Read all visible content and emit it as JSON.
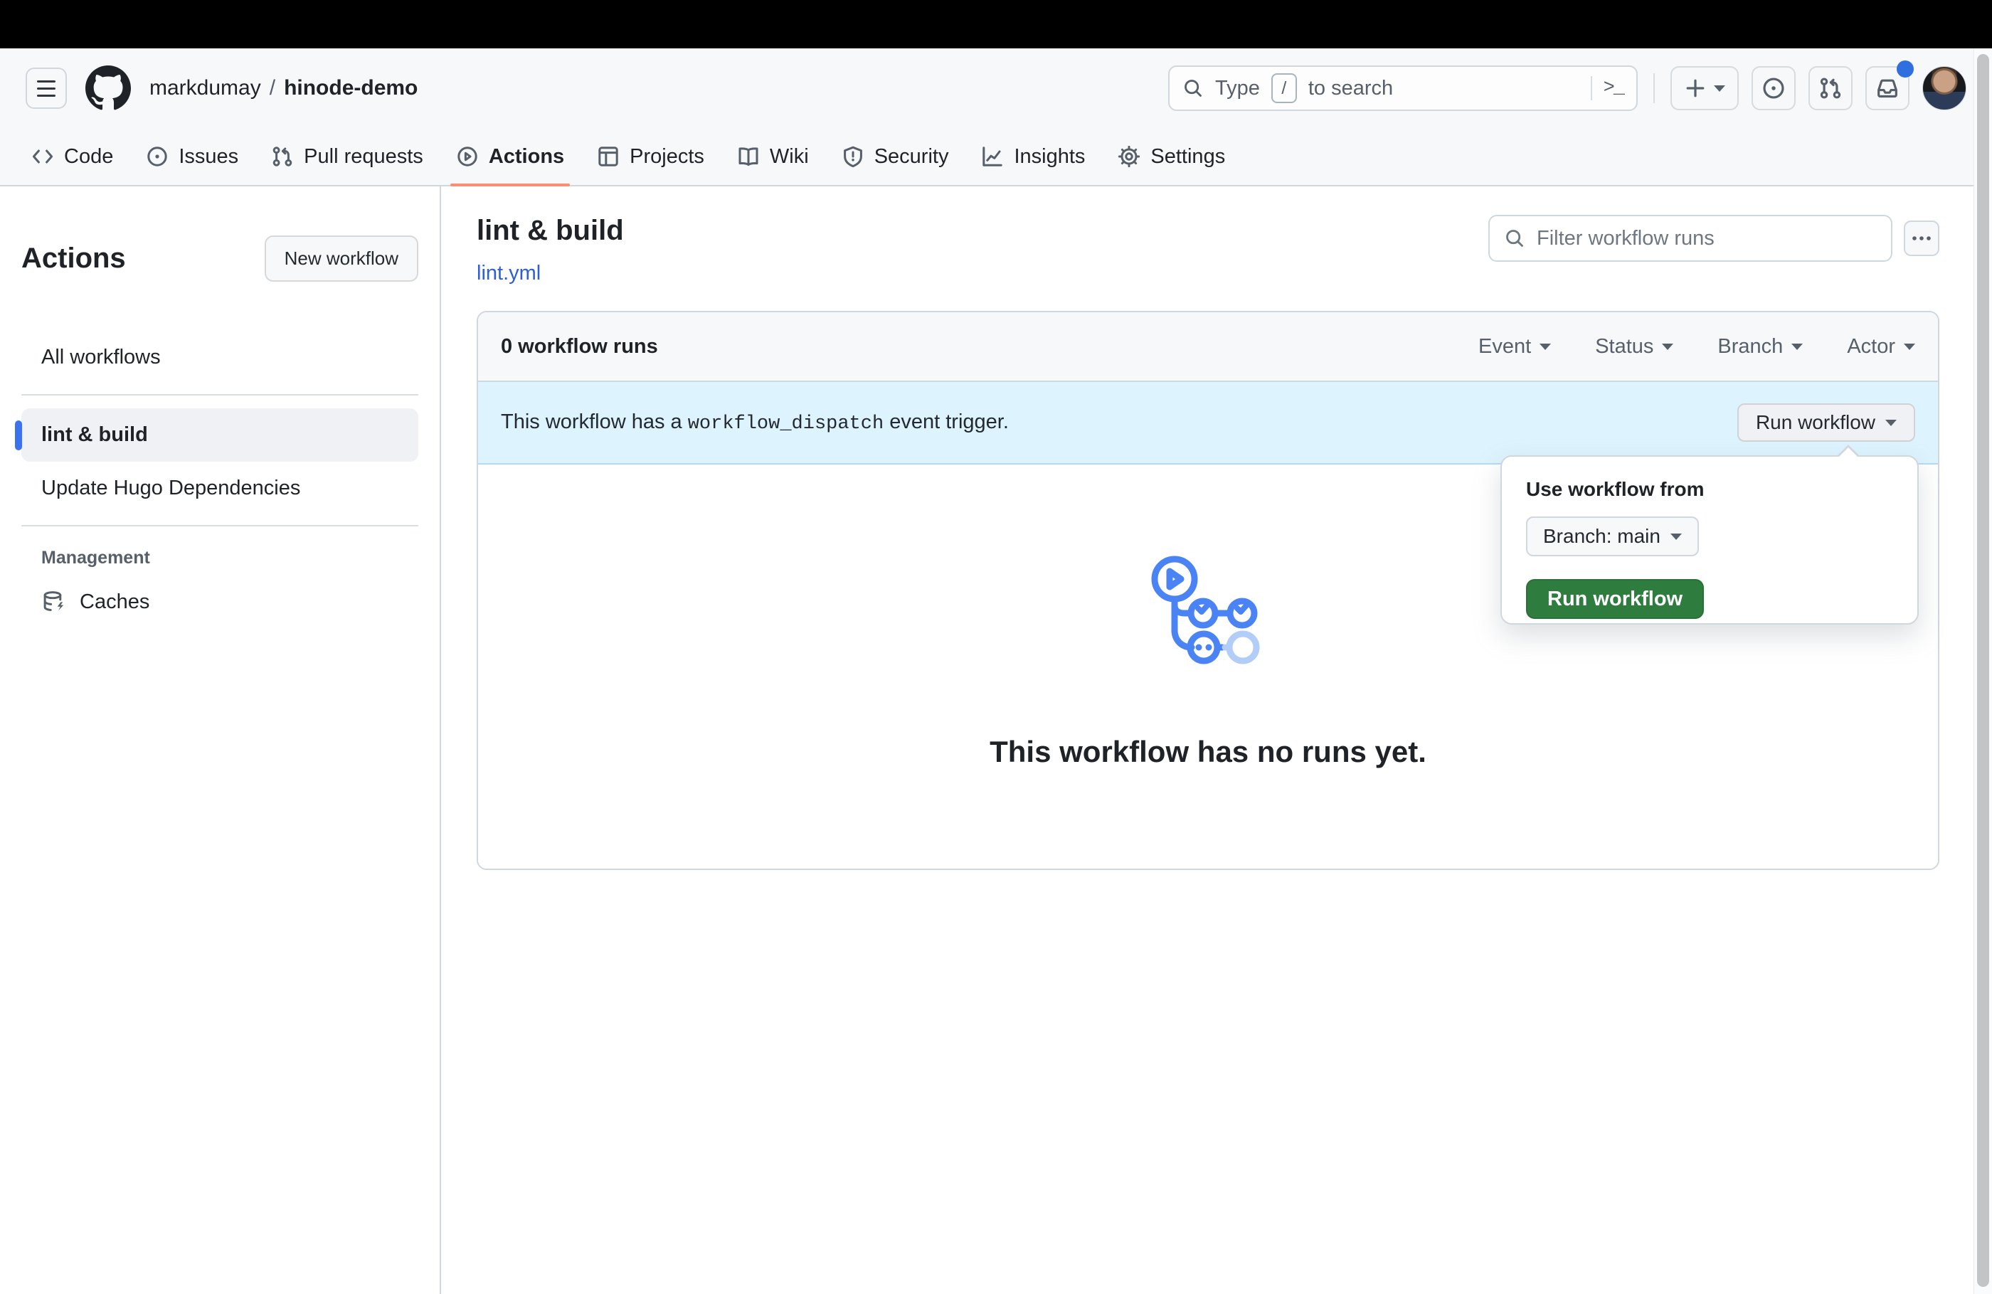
{
  "chrome": {
    "breadcrumb": {
      "owner": "markdumay",
      "separator": "/",
      "repo": "hinode-demo"
    },
    "search": {
      "pre": "Type",
      "slash_key": "/",
      "post": "to search",
      "terminal_glyph": ">_"
    },
    "nav": [
      "Code",
      "Issues",
      "Pull requests",
      "Actions",
      "Projects",
      "Wiki",
      "Security",
      "Insights",
      "Settings"
    ]
  },
  "sidebar": {
    "title": "Actions",
    "new_workflow_button": "New workflow",
    "all_workflows": "All workflows",
    "workflows": [
      "lint & build",
      "Update Hugo Dependencies"
    ],
    "selected_workflow": "lint & build",
    "management_label": "Management",
    "caches": "Caches"
  },
  "main": {
    "title": "lint & build",
    "file_link": "lint.yml",
    "filter_placeholder": "Filter workflow runs",
    "kebab_glyph": "⋯",
    "runs_count": "0 workflow runs",
    "filters": [
      "Event",
      "Status",
      "Branch",
      "Actor"
    ],
    "banner": {
      "pre": "This workflow has a",
      "code": "workflow_dispatch",
      "post": "event trigger."
    },
    "run_workflow_button": "Run workflow",
    "empty_heading": "This workflow has no runs yet."
  },
  "popup": {
    "title": "Use workflow from",
    "branch_button": "Branch: main",
    "run_button": "Run workflow"
  },
  "colors": {
    "accent": "#2d5fd9",
    "underline": "#fd8c73",
    "selbar": "#3b72ef",
    "banner": "#ddf4ff",
    "green": "#2f7d3e",
    "illus": "#4a84f4",
    "illus_faded": "#b3cdf9"
  }
}
